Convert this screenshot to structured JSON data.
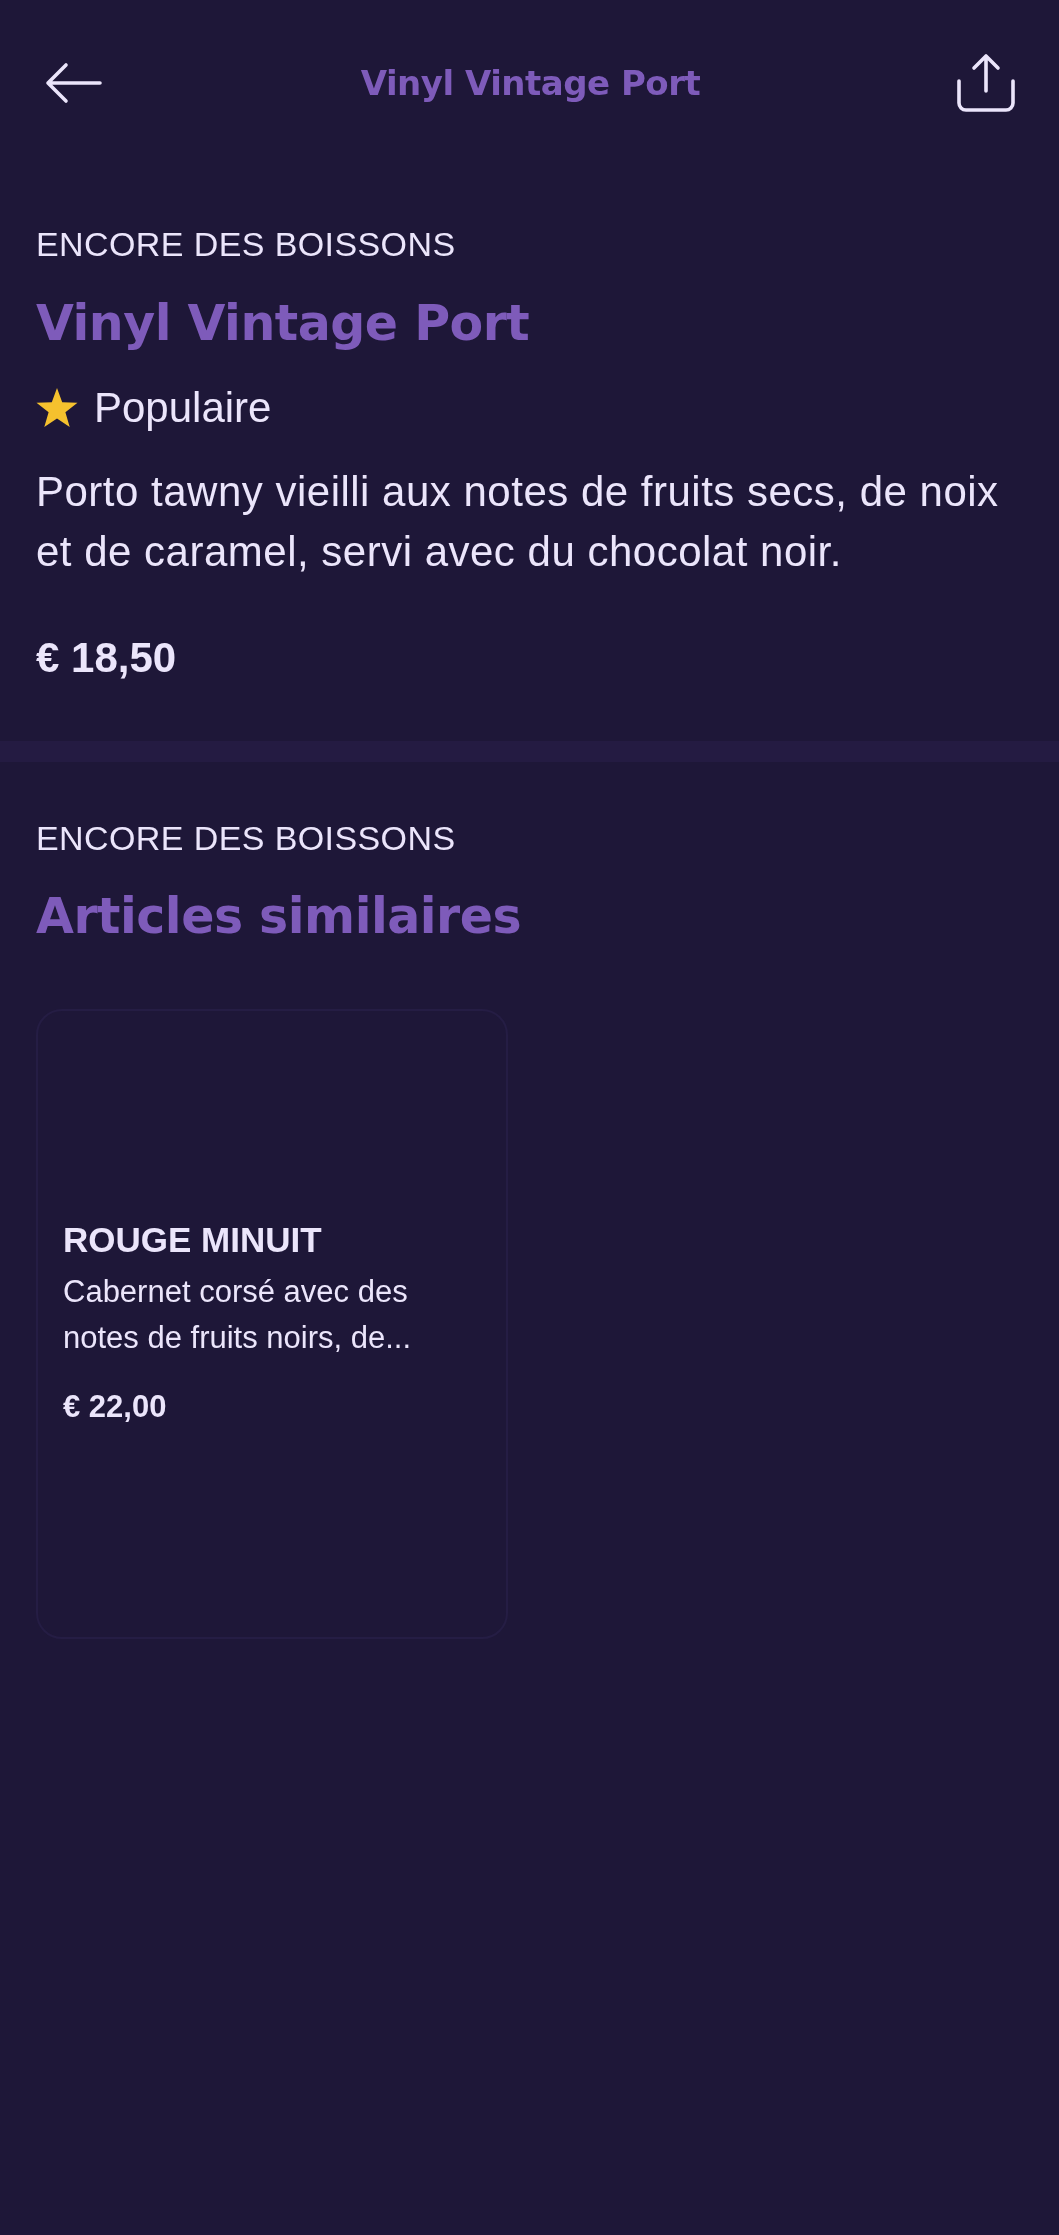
{
  "header": {
    "title": "Vinyl Vintage Port"
  },
  "product": {
    "category": "ENCORE DES BOISSONS",
    "name": "Vinyl Vintage Port",
    "tag": "Populaire",
    "description": "Porto tawny vieilli aux notes de fruits secs, de noix et de caramel, servi avec du chocolat noir.",
    "price": "€ 18,50"
  },
  "similar": {
    "category": "ENCORE DES BOISSONS",
    "title": "Articles similaires",
    "items": [
      {
        "name": "ROUGE MINUIT",
        "description": "Cabernet corsé avec des notes de fruits noirs, de...",
        "price": "€ 22,00"
      }
    ]
  }
}
